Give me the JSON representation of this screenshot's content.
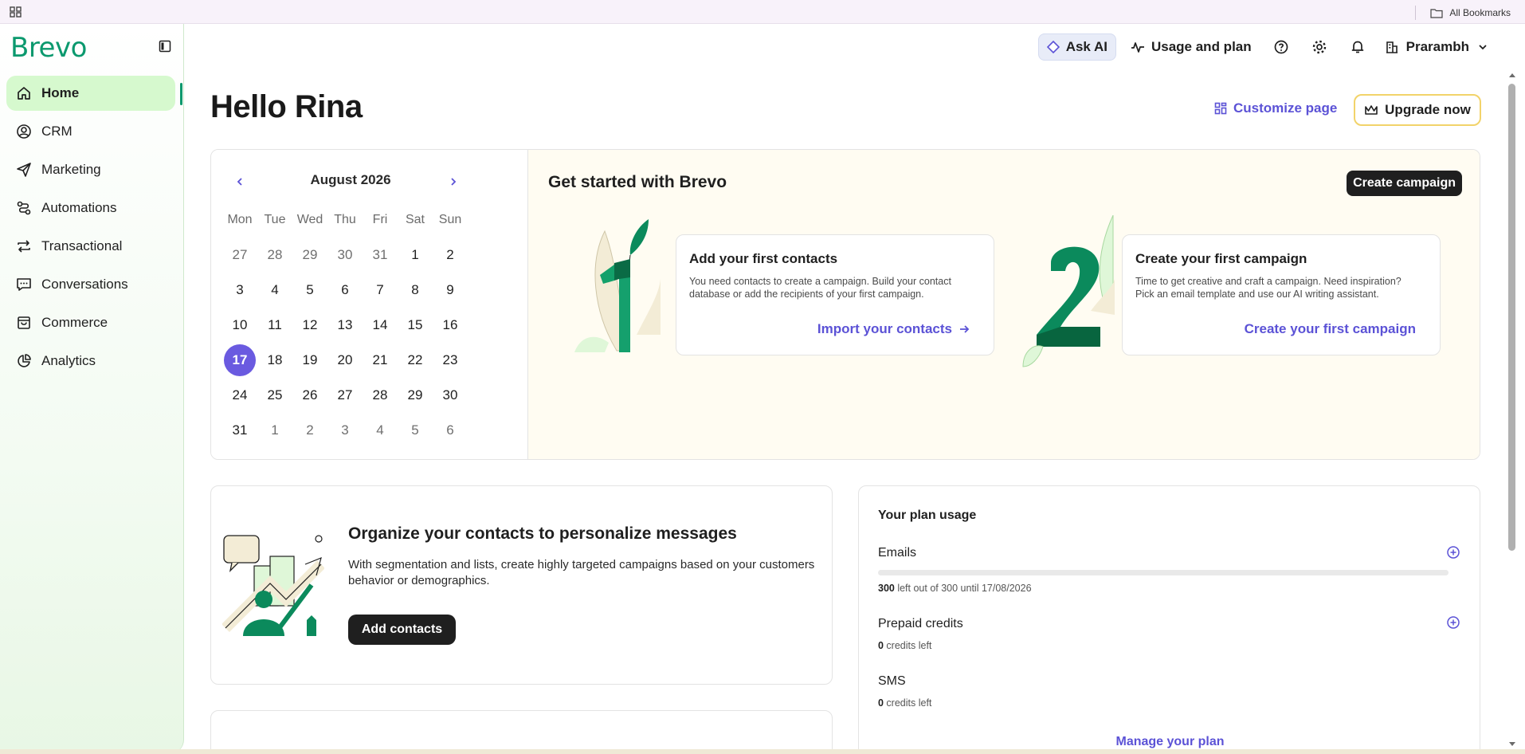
{
  "bookmarks": {
    "all_label": "All Bookmarks"
  },
  "brand": {
    "logo": "Brevo",
    "accent": "#0b996e",
    "purple": "#5b52d6"
  },
  "sidebar": {
    "items": [
      {
        "label": "Home",
        "icon": "home-icon",
        "active": true
      },
      {
        "label": "CRM",
        "icon": "contact-circle-icon"
      },
      {
        "label": "Marketing",
        "icon": "send-icon"
      },
      {
        "label": "Automations",
        "icon": "automation-icon"
      },
      {
        "label": "Transactional",
        "icon": "arrows-repeat-icon"
      },
      {
        "label": "Conversations",
        "icon": "chat-icon"
      },
      {
        "label": "Commerce",
        "icon": "shopping-bag-icon"
      },
      {
        "label": "Analytics",
        "icon": "pie-chart-icon"
      }
    ]
  },
  "topbar": {
    "ask_ai": "Ask AI",
    "usage": "Usage and plan",
    "account": "Prarambh"
  },
  "page": {
    "greeting": "Hello Rina",
    "customize": "Customize page",
    "upgrade": "Upgrade now"
  },
  "calendar": {
    "title": "August 2026",
    "weekdays": [
      "Mon",
      "Tue",
      "Wed",
      "Thu",
      "Fri",
      "Sat",
      "Sun"
    ],
    "weeks": [
      [
        "27",
        "28",
        "29",
        "30",
        "31",
        "1",
        "2"
      ],
      [
        "3",
        "4",
        "5",
        "6",
        "7",
        "8",
        "9"
      ],
      [
        "10",
        "11",
        "12",
        "13",
        "14",
        "15",
        "16"
      ],
      [
        "17",
        "18",
        "19",
        "20",
        "21",
        "22",
        "23"
      ],
      [
        "24",
        "25",
        "26",
        "27",
        "28",
        "29",
        "30"
      ],
      [
        "31",
        "1",
        "2",
        "3",
        "4",
        "5",
        "6"
      ]
    ],
    "today": "17"
  },
  "get_started": {
    "title": "Get started with Brevo",
    "create_campaign": "Create campaign",
    "step1": {
      "title": "Add your first contacts",
      "desc": "You need contacts to create a campaign. Build your contact database or add the recipients of your first campaign.",
      "link": "Import your contacts"
    },
    "step2": {
      "title": "Create your first campaign",
      "desc": "Time to get creative and craft a campaign. Need inspiration? Pick an email template and use our AI writing assistant.",
      "link": "Create your first campaign"
    }
  },
  "organize": {
    "title": "Organize your contacts to personalize messages",
    "desc": "With segmentation and lists, create highly targeted campaigns based on your customers behavior or demographics.",
    "button": "Add contacts"
  },
  "plan": {
    "title": "Your plan usage",
    "emails": {
      "label": "Emails",
      "count": "300",
      "rest": " left out of 300 until 17/08/2026",
      "used_fraction": 0
    },
    "prepaid": {
      "label": "Prepaid credits",
      "count": "0",
      "rest": " credits left"
    },
    "sms": {
      "label": "SMS",
      "count": "0",
      "rest": " credits left"
    },
    "manage": "Manage your plan"
  }
}
